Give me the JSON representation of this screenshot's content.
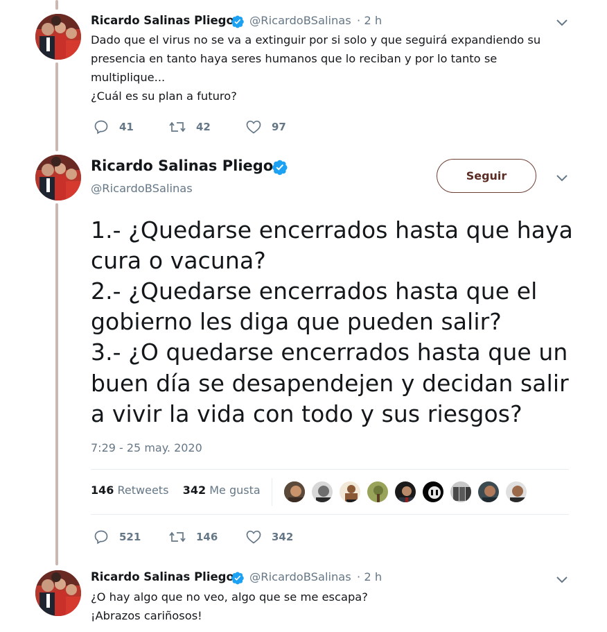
{
  "tweets": [
    {
      "name": "Ricardo Salinas Pliego",
      "handle": "@RicardoBSalinas",
      "time": "· 2 h",
      "lines": [
        "Dado que el virus no se va a extinguir por si solo y que seguirá expandiendo su",
        "presencia en tanto haya seres humanos que lo reciban y por lo tanto se",
        "multiplique...",
        "¿Cuál es su plan a futuro?"
      ],
      "replies": "41",
      "retweets": "42",
      "likes": "97"
    },
    {
      "name": "Ricardo Salinas Pliego",
      "handle": "@RicardoBSalinas",
      "follow_label": "Seguir",
      "lines": [
        "1.- ¿Quedarse encerrados hasta que haya",
        "cura o vacuna?",
        "2.- ¿Quedarse encerrados hasta que el",
        "gobierno les diga que pueden salir?",
        "3.- ¿O quedarse encerrados hasta que un",
        "buen día se desapendejen y decidan salir",
        "a vivir la vida con todo y sus riesgos?"
      ],
      "timestamp": "7:29 - 25 may. 2020",
      "retweet_count": "146",
      "retweet_label": "Retweets",
      "like_count": "342",
      "like_label": "Me gusta",
      "replies": "521",
      "retweets": "146",
      "likes": "342"
    },
    {
      "name": "Ricardo Salinas Pliego",
      "handle": "@RicardoBSalinas",
      "time": "· 2 h",
      "lines": [
        "¿O hay algo que no veo, algo que se me escapa?",
        "¡Abrazos cariñosos!"
      ]
    }
  ],
  "icons": {
    "reply": "reply-icon",
    "retweet": "retweet-icon",
    "like": "heart-icon",
    "verified": "verified-badge-icon",
    "more": "chevron-down-icon"
  },
  "colors": {
    "verified": "#1da1f2",
    "muted": "#657786",
    "thread_line": "#ccb8b2",
    "follow_border": "#6e3f36"
  }
}
